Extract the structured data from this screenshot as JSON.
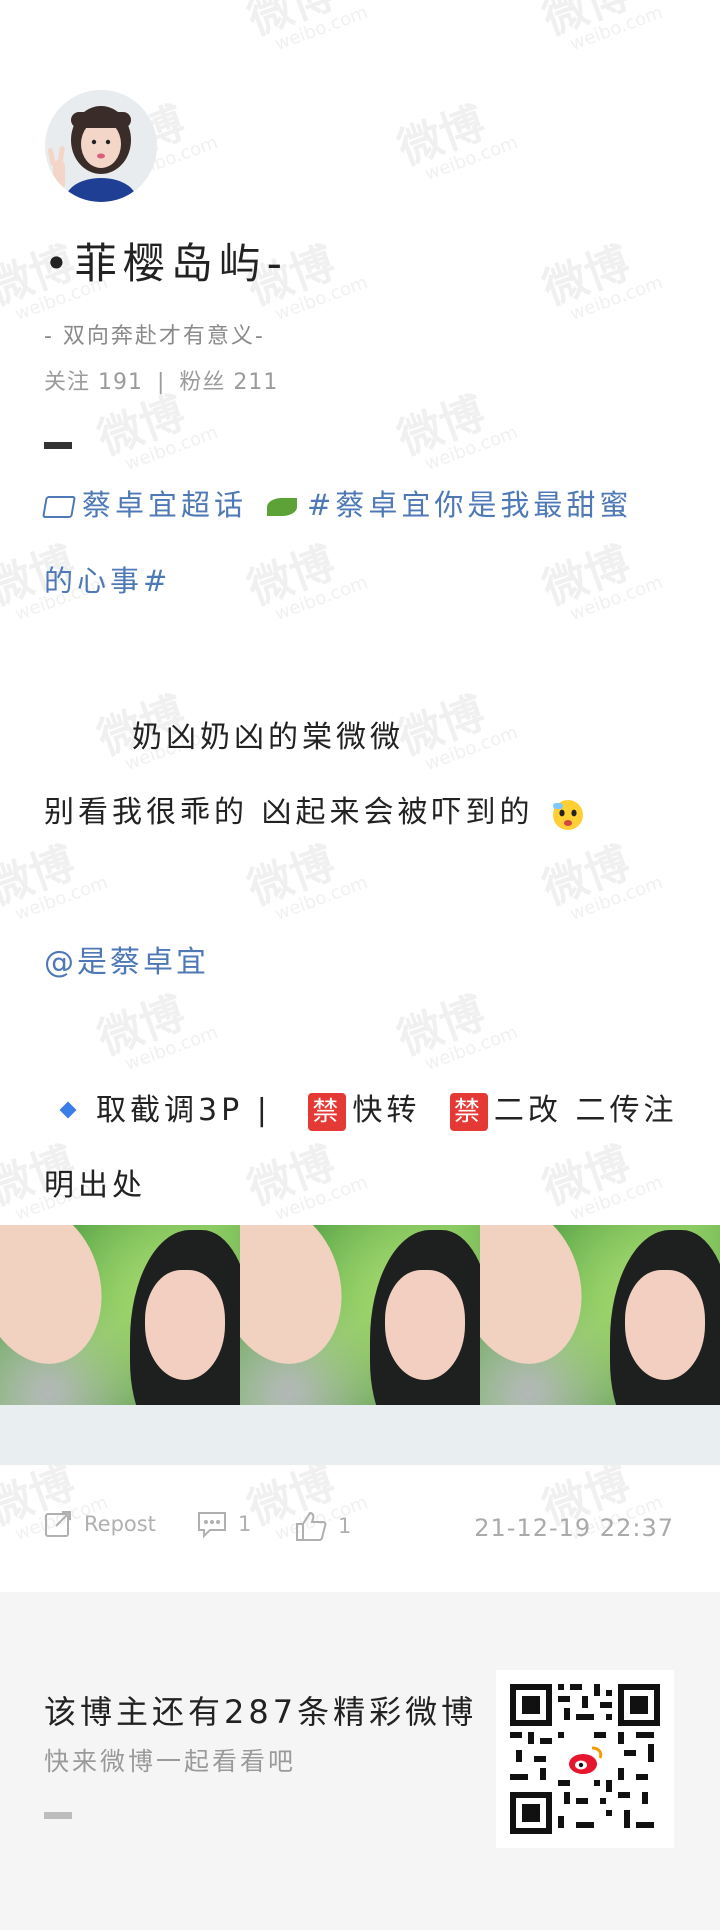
{
  "profile": {
    "name": "•菲樱岛屿-",
    "motto": "- 双向奔赴才有意义-",
    "following_label": "关注 191",
    "followers_label": "粉丝 211",
    "stats_separator": "|"
  },
  "post": {
    "topic_super": "蔡卓宜超话",
    "topic_hashtag_part1": "#蔡卓宜你是我最甜蜜",
    "topic_hashtag_part2": "的心事#",
    "line1": "奶凶奶凶的棠微微",
    "line2": "别看我很乖的 凶起来会被吓到的",
    "mention": "@是蔡卓宜",
    "notice_part1": "取截调3P |",
    "ban1": "禁",
    "notice_part2": "快转",
    "ban2": "禁",
    "notice_part3": "二改 二传注",
    "notice_line2": "明出处"
  },
  "actions": {
    "repost_label": "Repost",
    "comment_count": "1",
    "like_count": "1",
    "timestamp": "21-12-19 22:37"
  },
  "footer": {
    "title": "该博主还有287条精彩微博",
    "subtitle": "快来微博一起看看吧"
  },
  "colors": {
    "link_blue": "#4e79b6",
    "ban_red": "#e53935",
    "footer_bg": "#f5f5f5"
  }
}
